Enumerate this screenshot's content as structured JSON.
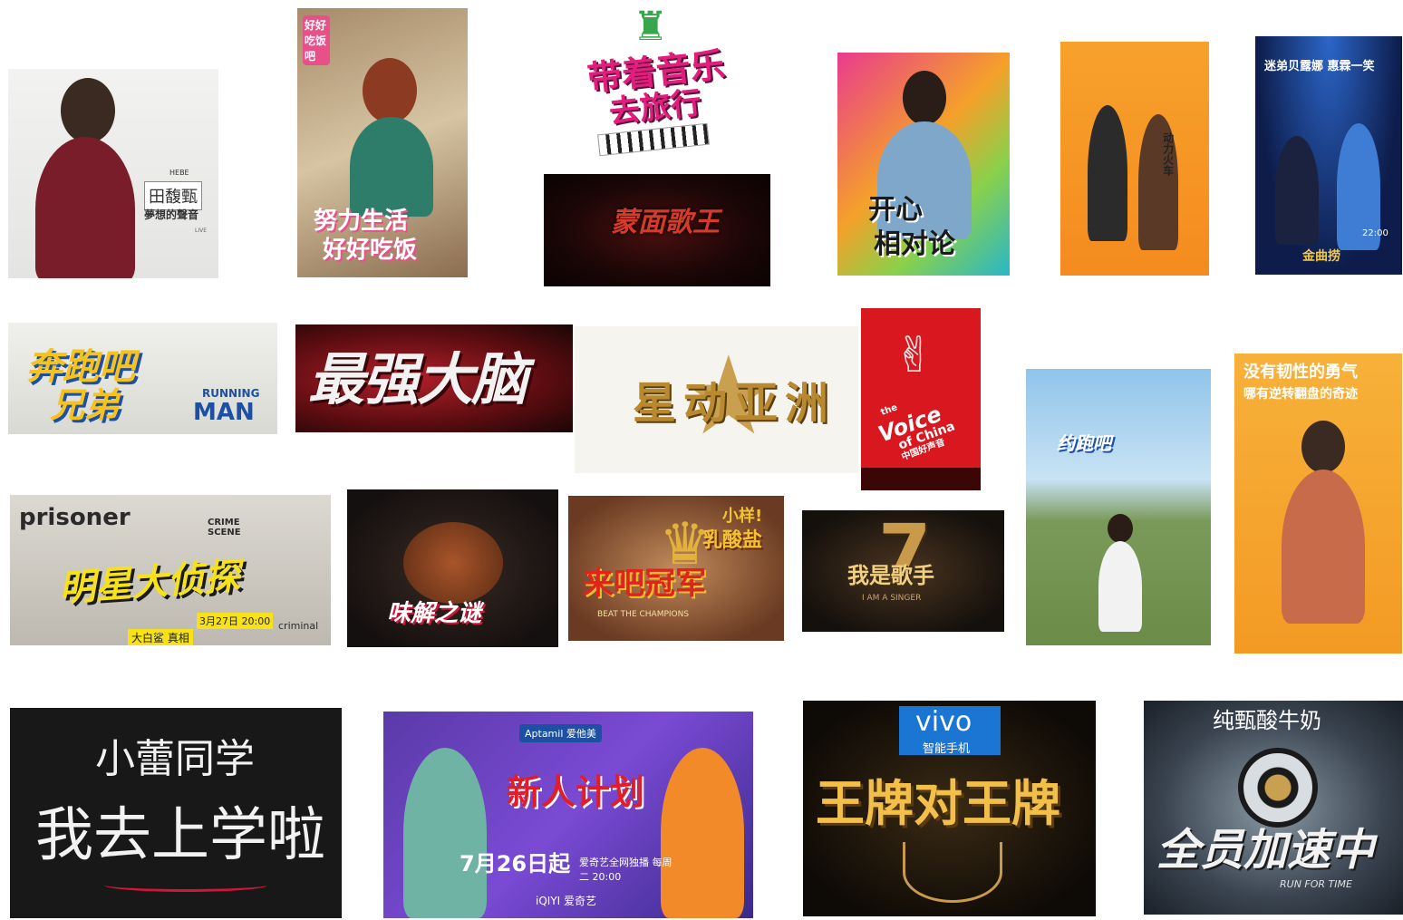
{
  "tiles": {
    "hebe": {
      "name_en": "HEBE",
      "name_zh": "田馥甄",
      "subtitle": "夢想的聲音",
      "tag": "LIVE"
    },
    "haohao": {
      "badge": "好好吃饭吧",
      "line1": "努力生活",
      "line2": "好好吃饭"
    },
    "travel": {
      "line1": "带着音乐",
      "line2": "去旅行"
    },
    "mask": {
      "title": "蒙面歌王"
    },
    "kaixin": {
      "line1": "开心",
      "line2": "相对论"
    },
    "train": {
      "title": "动力火车"
    },
    "jinqu": {
      "top": "迷弟贝露娜 惠霖一笑",
      "bottom": "金曲捞",
      "time": "22:00"
    },
    "running": {
      "line1": "奔跑吧",
      "line2": "兄弟",
      "en1": "RUNNING",
      "en2": "MAN"
    },
    "brain": {
      "title": "最强大脑"
    },
    "asia": {
      "title": "星动亚洲"
    },
    "voice": {
      "en1": "the",
      "en2": "Voice",
      "en3": "of China",
      "zh": "中国好声音"
    },
    "yuepao": {
      "title": "约跑吧"
    },
    "sunny": {
      "line1": "没有韧性的勇气",
      "line2": "哪有逆转翻盘的奇迹"
    },
    "crime": {
      "en": "prisoner",
      "badge": "CRIME SCENE",
      "zh": "明星大侦探",
      "date": "3月27日 20:00",
      "en2": "criminal",
      "bottom": "大白鲨 真相"
    },
    "taste": {
      "title": "味解之谜"
    },
    "champ": {
      "top": "小样!",
      "mid": "乳酸盐",
      "title": "来吧冠军",
      "en": "BEAT THE CHAMPIONS"
    },
    "singer": {
      "num": "7",
      "title": "我是歌手",
      "en": "I AM A SINGER"
    },
    "school": {
      "line1": "小蕾同学",
      "line2": "我去上学啦"
    },
    "xinren": {
      "brand": "Aptamil 爱他美",
      "title": "新人计划",
      "date": "7月26日起",
      "line": "爱奇艺全网独播 每周二 20:00",
      "logo": "iQIYI 爱奇艺"
    },
    "ace": {
      "brand": "vivo",
      "brand_sub": "智能手机",
      "title": "王牌对王牌"
    },
    "run": {
      "brand": "纯甄酸牛奶",
      "title": "全员加速中",
      "en": "RUN FOR TIME"
    }
  },
  "colors": {
    "accent_red": "#c8102e",
    "gold": "#d9a23a"
  }
}
